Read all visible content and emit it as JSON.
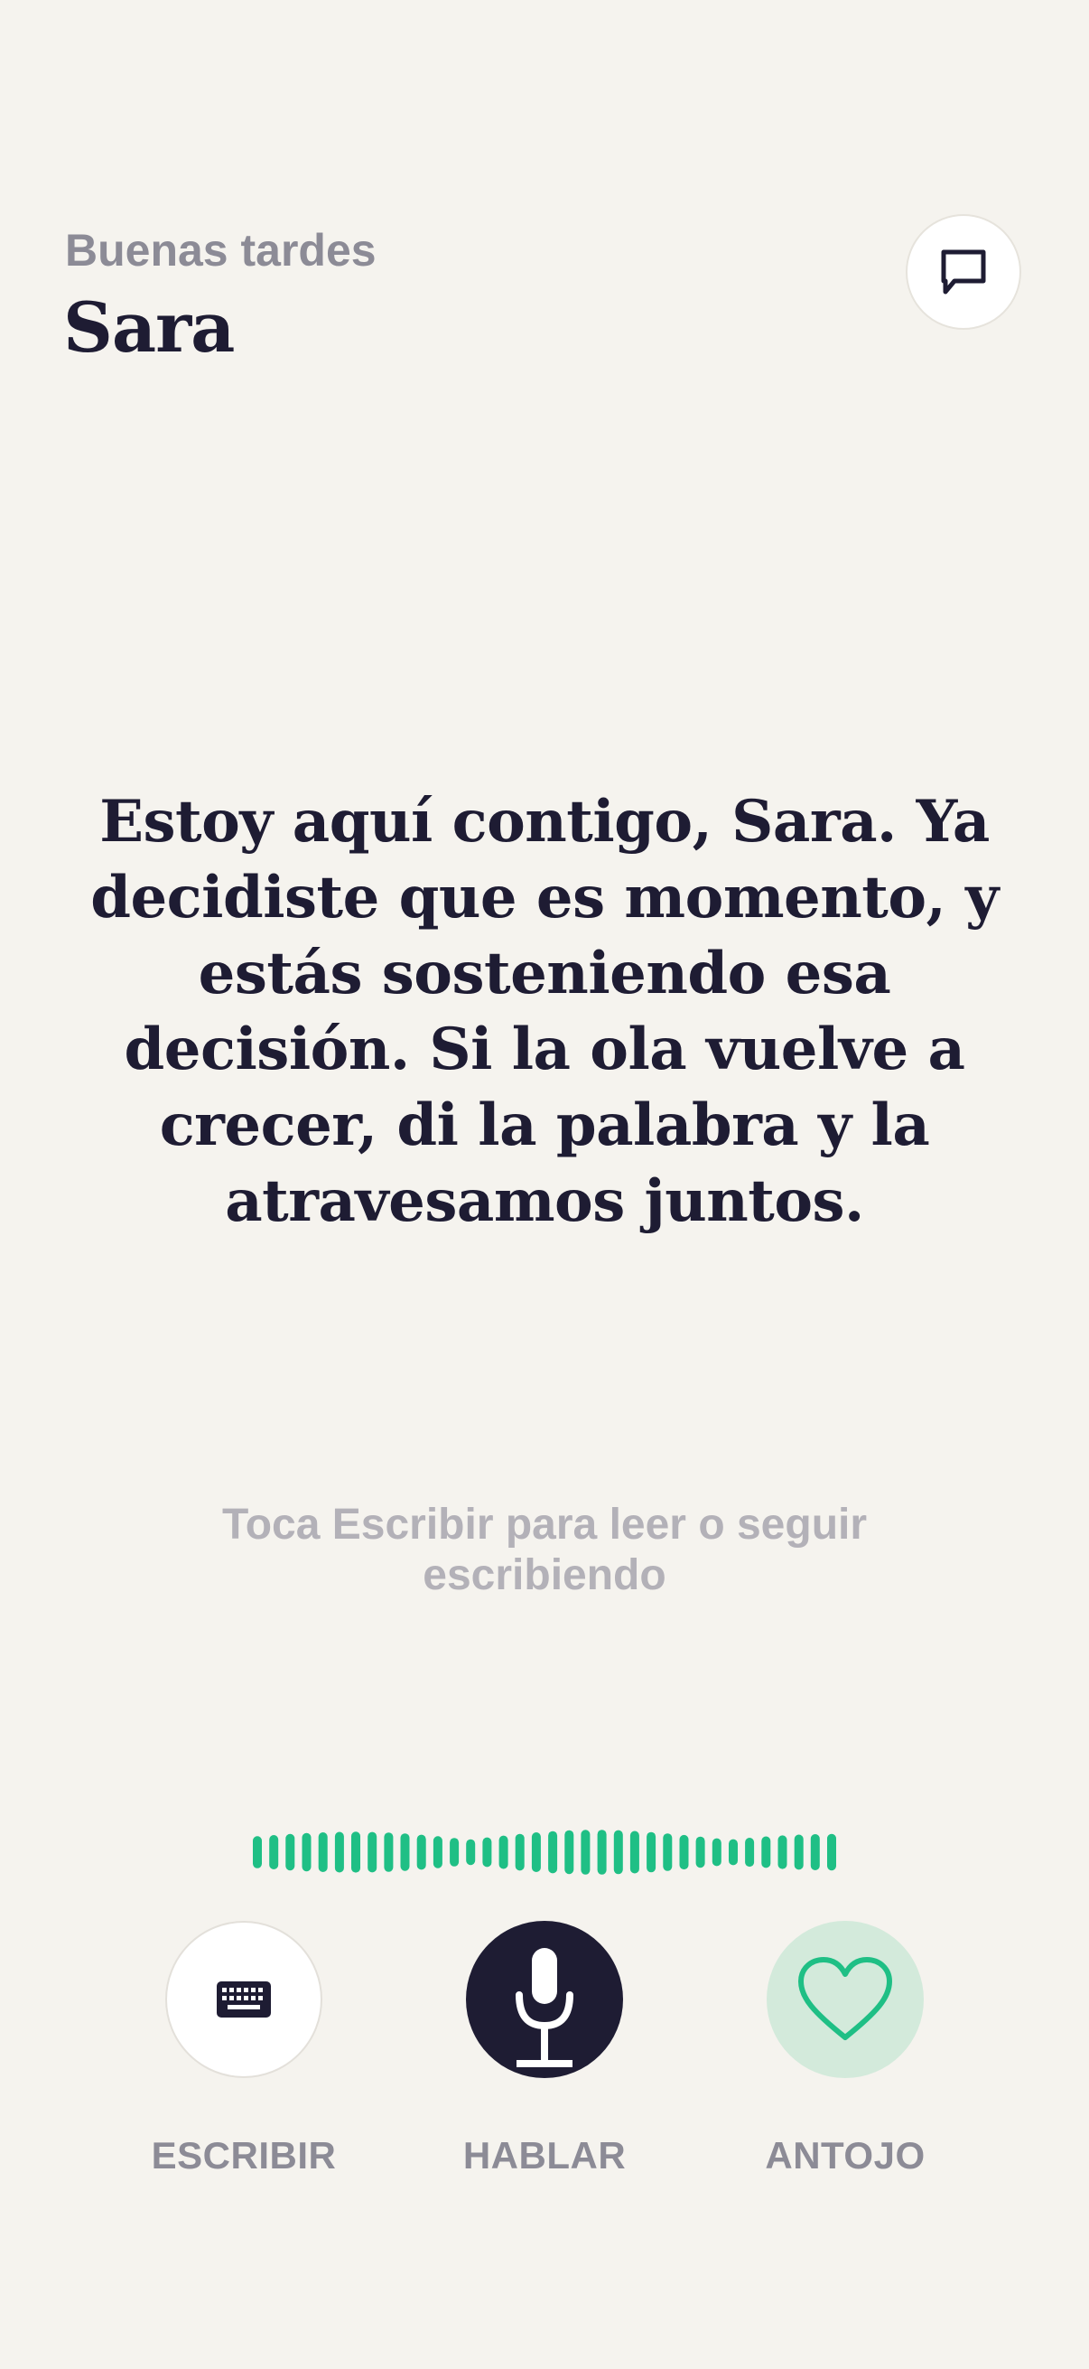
{
  "header": {
    "greeting": "Buenas tardes",
    "name": "Sara",
    "chat_icon": "speech-bubble-icon"
  },
  "main": {
    "message": "Estoy aquí contigo, Sara. Ya decidiste que es momento, y estás sosteniendo esa decisión. Si la ola vuelve a crecer, di la palabra y la atravesamos juntos.",
    "hint": "Toca Escribir para leer o seguir escribiendo"
  },
  "waveform": {
    "color": "#1fbf85",
    "icon": "audio-waveform"
  },
  "actions": {
    "write": {
      "label": "ESCRIBIR",
      "icon": "keyboard-icon"
    },
    "speak": {
      "label": "HABLAR",
      "icon": "microphone-icon"
    },
    "craving": {
      "label": "ANTOJO",
      "icon": "heart-icon"
    }
  },
  "colors": {
    "background": "#f5f3ee",
    "ink": "#1e1c33",
    "muted": "#8c8b96",
    "accent_green": "#1fbf85",
    "craving_bg": "#d3eadb"
  }
}
